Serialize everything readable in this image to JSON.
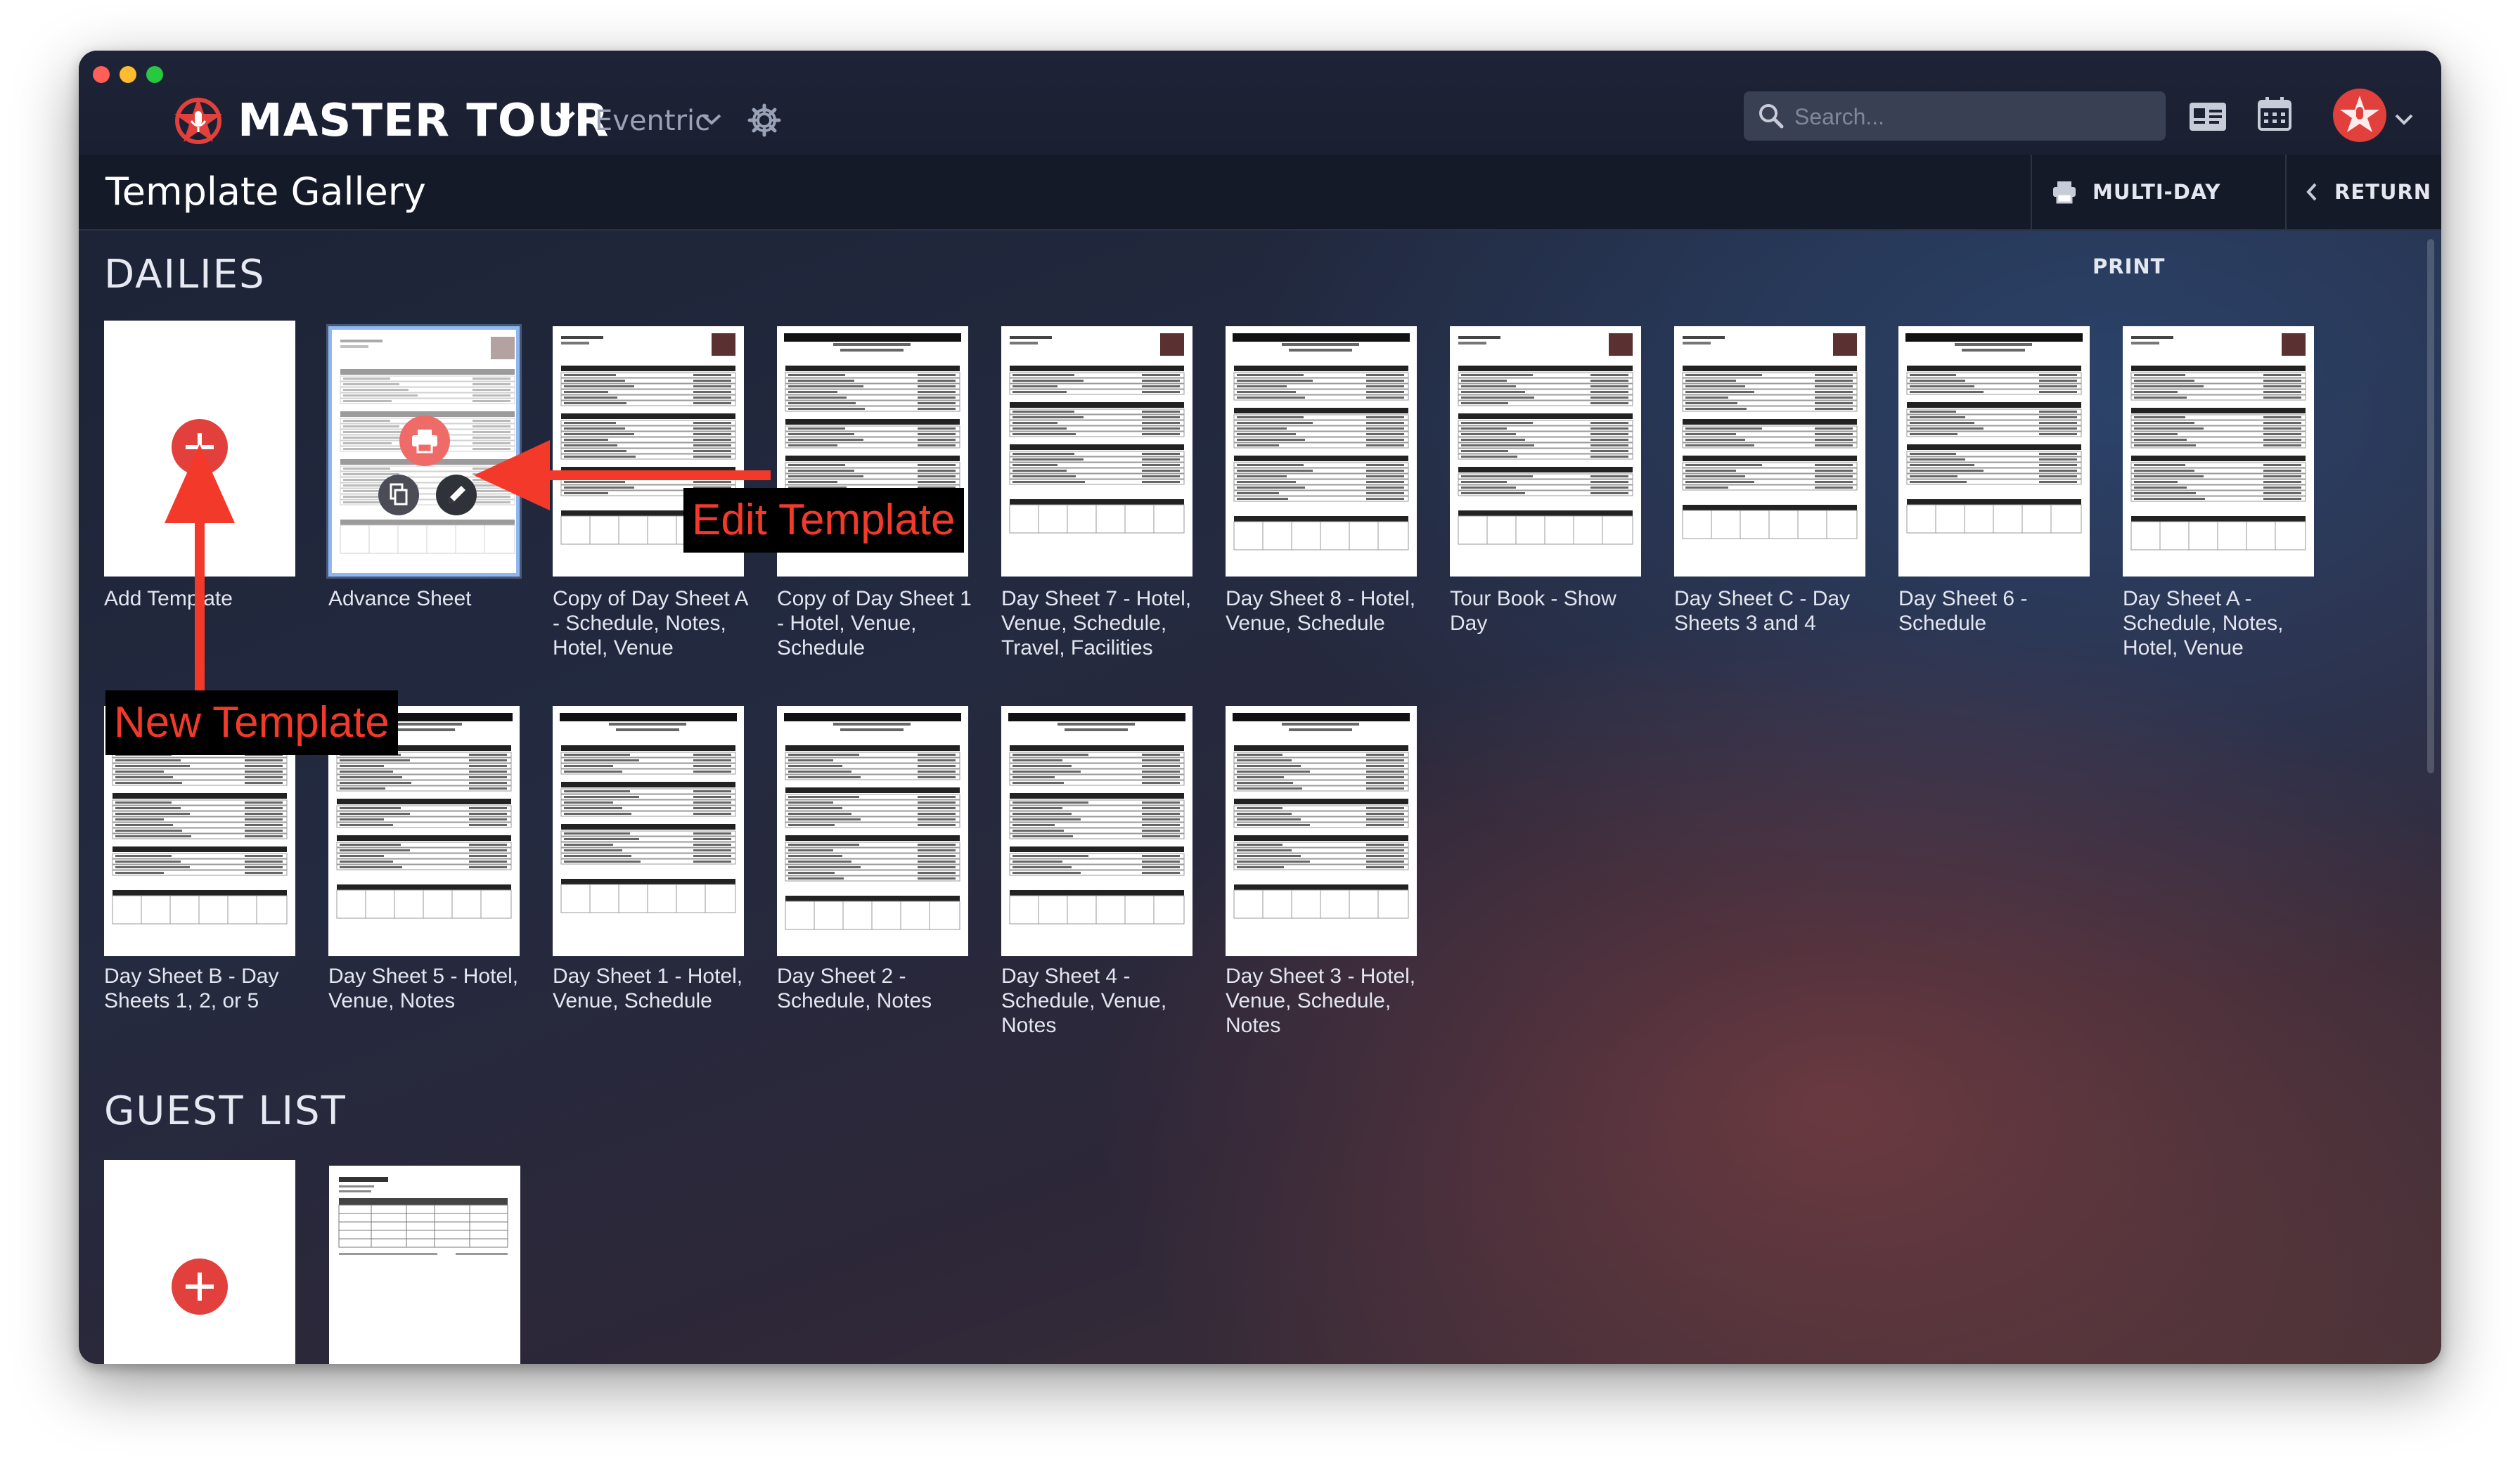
{
  "app": {
    "brand": "MASTER TOUR",
    "org": "Eventric"
  },
  "toolbar": {
    "search_placeholder": "Search..."
  },
  "subbar": {
    "title": "Template Gallery",
    "multi_day_print": "MULTI-DAY PRINT",
    "return": "RETURN"
  },
  "sections": {
    "dailies": "DAILIES",
    "guest_list": "GUEST LIST"
  },
  "dailies": [
    {
      "label": "Add Template"
    },
    {
      "label": "Advance Sheet"
    },
    {
      "label": "Copy of Day Sheet A - Schedule, Notes, Hotel, Venue"
    },
    {
      "label": "Copy of Day Sheet 1 - Hotel, Venue, Schedule"
    },
    {
      "label": "Day Sheet 7 - Hotel, Venue, Schedule, Travel, Facilities"
    },
    {
      "label": "Day Sheet 8 - Hotel, Venue, Schedule"
    },
    {
      "label": "Tour Book - Show Day"
    },
    {
      "label": "Day Sheet C - Day Sheets 3 and 4"
    },
    {
      "label": "Day Sheet 6 - Schedule"
    },
    {
      "label": "Day Sheet A - Schedule, Notes, Hotel, Venue"
    },
    {
      "label": "Day Sheet B - Day Sheets 1, 2, or 5"
    },
    {
      "label": "Day Sheet 5 - Hotel, Venue, Notes"
    },
    {
      "label": "Day Sheet 1 - Hotel, Venue, Schedule"
    },
    {
      "label": "Day Sheet 2 - Schedule, Notes"
    },
    {
      "label": "Day Sheet 4 - Schedule, Venue, Notes"
    },
    {
      "label": "Day Sheet 3 - Hotel, Venue, Schedule, Notes"
    }
  ],
  "annotations": {
    "edit_template": "Edit Template",
    "new_template": "New Template"
  },
  "colors": {
    "accent_red": "#e2403c",
    "annotation_red": "#f33a2a",
    "selected_border": "#8fb6ef"
  }
}
